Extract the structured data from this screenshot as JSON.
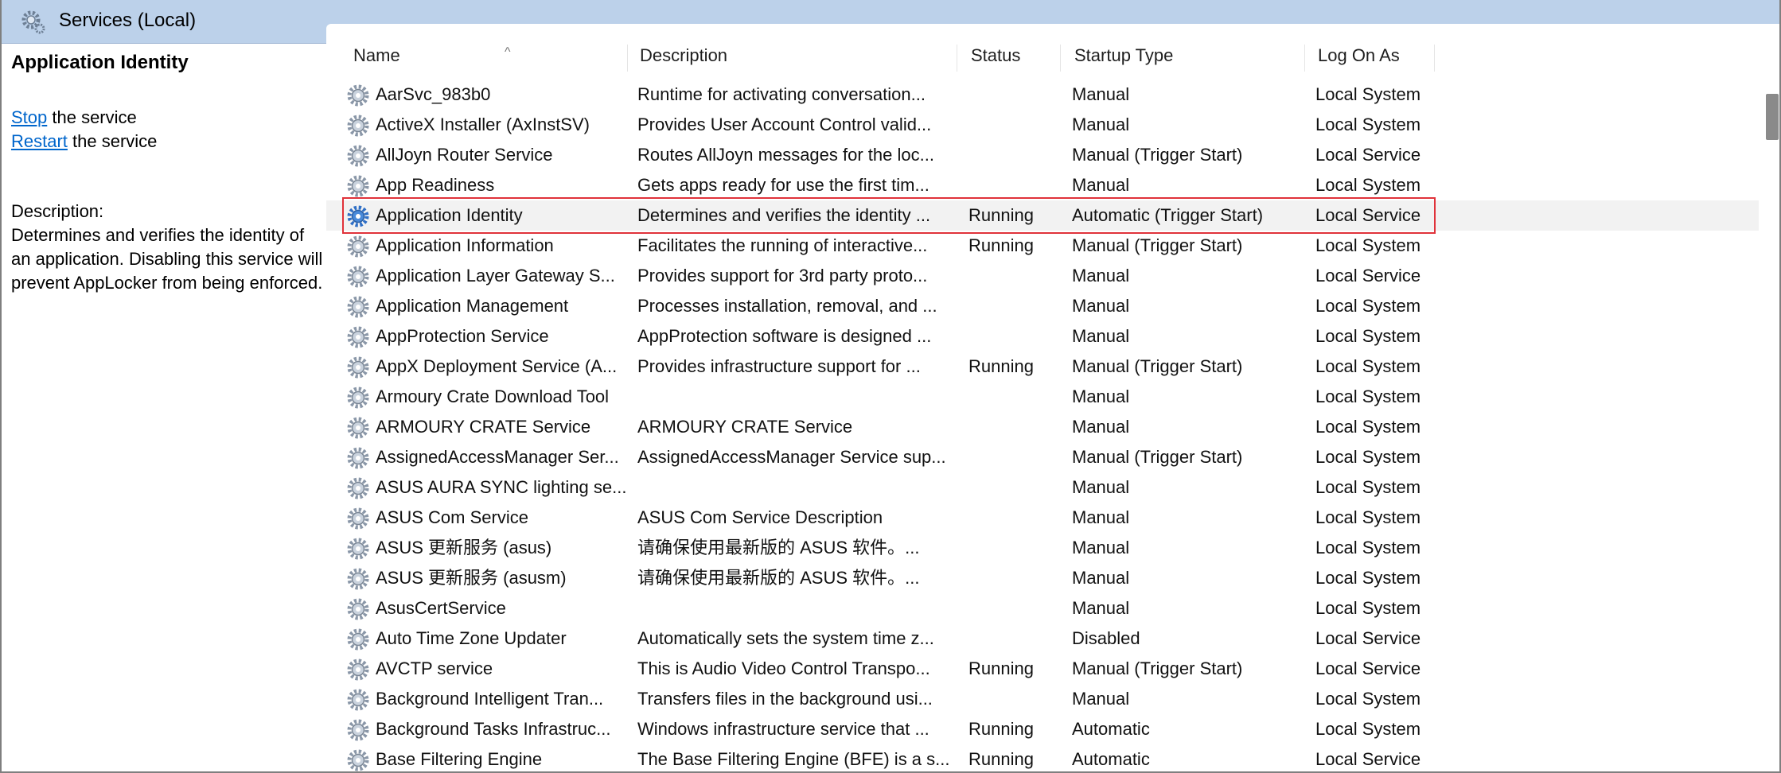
{
  "header": {
    "title": "Services (Local)"
  },
  "details": {
    "service_name": "Application Identity",
    "stop_link": "Stop",
    "stop_suffix": " the service",
    "restart_link": "Restart",
    "restart_suffix": " the service",
    "description_label": "Description:",
    "description_text": "Determines and verifies the identity of an application. Disabling this service will prevent AppLocker from being enforced."
  },
  "columns": {
    "name": "Name",
    "description": "Description",
    "status": "Status",
    "startup_type": "Startup Type",
    "log_on_as": "Log On As",
    "sort_indicator": "^"
  },
  "selected_row": 4,
  "colors": {
    "header_band": "#bcd1ea",
    "link": "#0066cc",
    "selection_outline": "#e0323a"
  },
  "services": [
    {
      "name": "AarSvc_983b0",
      "description": "Runtime for activating conversation...",
      "status": "",
      "startup": "Manual",
      "logon": "Local System"
    },
    {
      "name": "ActiveX Installer (AxInstSV)",
      "description": "Provides User Account Control valid...",
      "status": "",
      "startup": "Manual",
      "logon": "Local System"
    },
    {
      "name": "AllJoyn Router Service",
      "description": "Routes AllJoyn messages for the loc...",
      "status": "",
      "startup": "Manual (Trigger Start)",
      "logon": "Local Service"
    },
    {
      "name": "App Readiness",
      "description": "Gets apps ready for use the first tim...",
      "status": "",
      "startup": "Manual",
      "logon": "Local System"
    },
    {
      "name": "Application Identity",
      "description": "Determines and verifies the identity ...",
      "status": "Running",
      "startup": "Automatic (Trigger Start)",
      "logon": "Local Service"
    },
    {
      "name": "Application Information",
      "description": "Facilitates the running of interactive...",
      "status": "Running",
      "startup": "Manual (Trigger Start)",
      "logon": "Local System"
    },
    {
      "name": "Application Layer Gateway S...",
      "description": "Provides support for 3rd party proto...",
      "status": "",
      "startup": "Manual",
      "logon": "Local Service"
    },
    {
      "name": "Application Management",
      "description": "Processes installation, removal, and ...",
      "status": "",
      "startup": "Manual",
      "logon": "Local System"
    },
    {
      "name": "AppProtection Service",
      "description": "AppProtection software is designed ...",
      "status": "",
      "startup": "Manual",
      "logon": "Local System"
    },
    {
      "name": "AppX Deployment Service (A...",
      "description": "Provides infrastructure support for ...",
      "status": "Running",
      "startup": "Manual (Trigger Start)",
      "logon": "Local System"
    },
    {
      "name": "Armoury Crate Download Tool",
      "description": "",
      "status": "",
      "startup": "Manual",
      "logon": "Local System"
    },
    {
      "name": "ARMOURY CRATE Service",
      "description": "ARMOURY CRATE Service",
      "status": "",
      "startup": "Manual",
      "logon": "Local System"
    },
    {
      "name": "AssignedAccessManager Ser...",
      "description": "AssignedAccessManager Service sup...",
      "status": "",
      "startup": "Manual (Trigger Start)",
      "logon": "Local System"
    },
    {
      "name": "ASUS AURA SYNC lighting se...",
      "description": "",
      "status": "",
      "startup": "Manual",
      "logon": "Local System"
    },
    {
      "name": "ASUS Com Service",
      "description": "ASUS Com Service Description",
      "status": "",
      "startup": "Manual",
      "logon": "Local System"
    },
    {
      "name": "ASUS 更新服务 (asus)",
      "description": "请确保使用最新版的 ASUS 软件。...",
      "status": "",
      "startup": "Manual",
      "logon": "Local System"
    },
    {
      "name": "ASUS 更新服务 (asusm)",
      "description": "请确保使用最新版的 ASUS 软件。...",
      "status": "",
      "startup": "Manual",
      "logon": "Local System"
    },
    {
      "name": "AsusCertService",
      "description": "",
      "status": "",
      "startup": "Manual",
      "logon": "Local System"
    },
    {
      "name": "Auto Time Zone Updater",
      "description": "Automatically sets the system time z...",
      "status": "",
      "startup": "Disabled",
      "logon": "Local Service"
    },
    {
      "name": "AVCTP service",
      "description": "This is Audio Video Control Transpo...",
      "status": "Running",
      "startup": "Manual (Trigger Start)",
      "logon": "Local Service"
    },
    {
      "name": "Background Intelligent Tran...",
      "description": "Transfers files in the background usi...",
      "status": "",
      "startup": "Manual",
      "logon": "Local System"
    },
    {
      "name": "Background Tasks Infrastruc...",
      "description": "Windows infrastructure service that ...",
      "status": "Running",
      "startup": "Automatic",
      "logon": "Local System"
    },
    {
      "name": "Base Filtering Engine",
      "description": "The Base Filtering Engine (BFE) is a s...",
      "status": "Running",
      "startup": "Automatic",
      "logon": "Local Service"
    }
  ]
}
